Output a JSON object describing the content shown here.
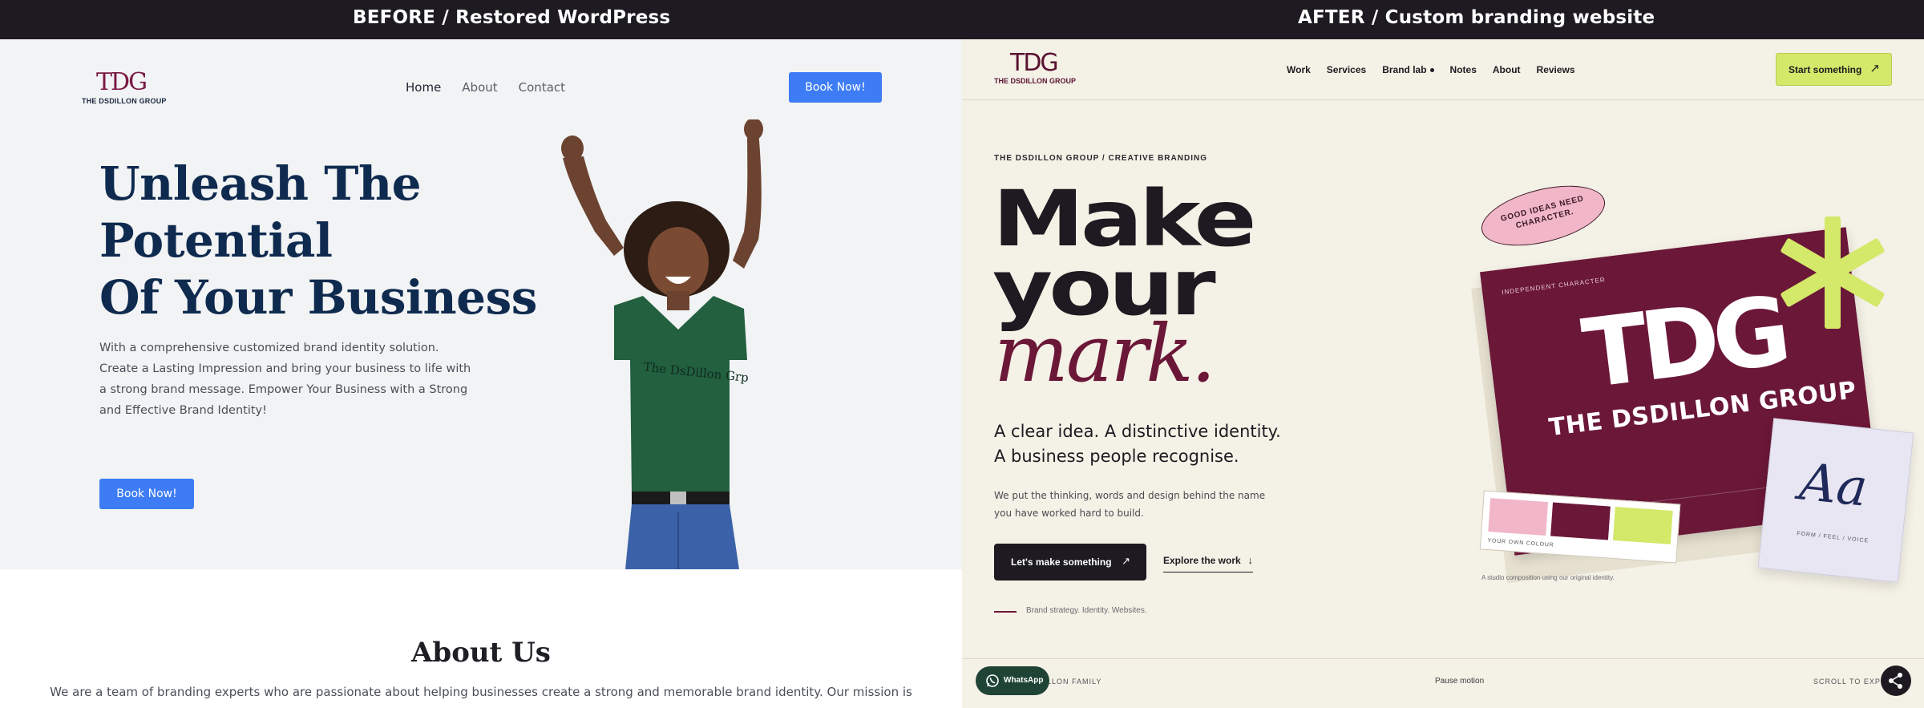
{
  "topbar": {
    "left_caption": "BEFORE / Restored WordPress",
    "right_caption": "AFTER / Custom branding website"
  },
  "before": {
    "logo": {
      "mark": "TDG",
      "name": "THE DSDILLON GROUP"
    },
    "nav": [
      "Home",
      "About",
      "Contact"
    ],
    "nav_active": "Home",
    "cta": "Book Now!",
    "hero_title": [
      "Unleash The",
      "Potential",
      "Of Your Business"
    ],
    "hero_desc": "With a comprehensive customized brand identity solution. Create a Lasting Impression and bring your business to life with a strong brand message. Empower Your Business with a Strong and Effective Brand Identity!",
    "hero_button": "Book Now!",
    "about_title": "About Us",
    "about_text": "We are a team of branding experts who are passionate about helping businesses create a strong and memorable brand identity. Our mission is",
    "colors": {
      "hero_bg": "#f1f3f4",
      "title": "#0f2a4f",
      "button": "#3d7cf4"
    }
  },
  "after": {
    "logo": {
      "mark": "TDG",
      "name": "THE DSDILLON GROUP"
    },
    "nav": [
      "Work",
      "Services",
      "Brand lab",
      "Notes",
      "About",
      "Reviews"
    ],
    "start_button": "Start something",
    "kicker": "THE DSDILLON GROUP / CREATIVE BRANDING",
    "title": [
      "Make",
      "your",
      "mark."
    ],
    "subtitle": [
      "A clear idea. A distinctive identity.",
      "A business people recognise."
    ],
    "description": "We put the thinking, words and design behind the name you have worked hard to build.",
    "primary_button": "Let's make something",
    "secondary_button": "Explore the work",
    "tagline": "Brand strategy. Identity. Websites.",
    "art": {
      "pill": "GOOD IDEAS NEED CHARACTER.",
      "card_kicker": "INDEPENDENT CHARACTER",
      "card_mark": "TDG",
      "card_name": "THE DSDILLON GROUP",
      "swatch_label": "YOUR OWN COLOUR",
      "type_glyph": "Aa",
      "type_label": "FORM / FEEL / VOICE",
      "caption": "A studio composition using our original identity."
    },
    "footer": {
      "left": "DILLON FAMILY",
      "center": "Pause motion",
      "right": "SCROLL TO EXPLORE"
    },
    "whatsapp": "WhatsApp",
    "colors": {
      "bg": "#f4f1e6",
      "plum": "#6b1738",
      "lime": "#d4e86a",
      "pink": "#f1b6c7",
      "ink": "#1d1b21"
    },
    "icons": {
      "start_arrow": "arrow-up-right-icon",
      "explore_arrow": "arrow-down-icon",
      "share": "share-icon",
      "whatsapp": "whatsapp-icon"
    }
  }
}
